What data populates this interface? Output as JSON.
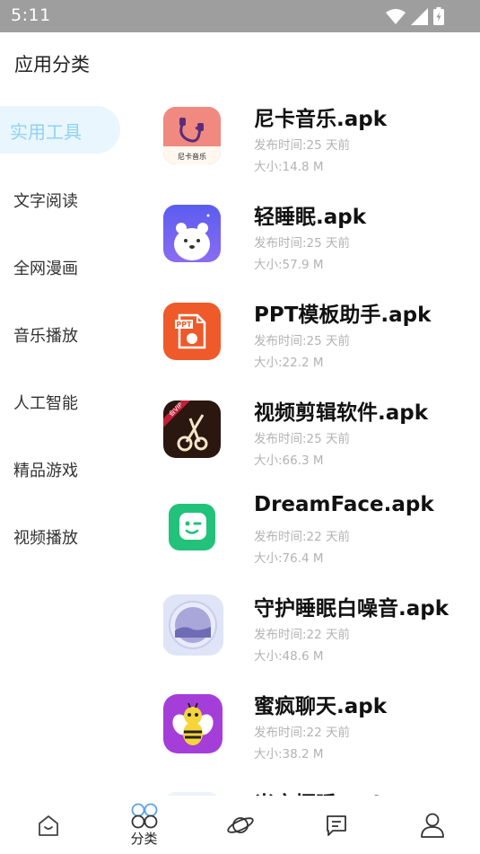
{
  "status_bar": {
    "time": "5:11"
  },
  "header": {
    "title": "应用分类"
  },
  "sidebar": {
    "items": [
      {
        "label": "实用工具",
        "active": true
      },
      {
        "label": "文字阅读"
      },
      {
        "label": "全网漫画"
      },
      {
        "label": "音乐播放"
      },
      {
        "label": "人工智能"
      },
      {
        "label": "精品游戏"
      },
      {
        "label": "视频播放"
      }
    ]
  },
  "apps": [
    {
      "name": "尼卡音乐.apk",
      "date": "发布时间:25 天前",
      "size": "大小:14.8 M",
      "icon": "nika-music-icon",
      "icon_text": "尼卡音乐"
    },
    {
      "name": "轻睡眠.apk",
      "date": "发布时间:25 天前",
      "size": "大小:57.9 M",
      "icon": "polar-bear-icon"
    },
    {
      "name": "PPT模板助手.apk",
      "date": "发布时间:25 天前",
      "size": "大小:22.2 M",
      "icon": "ppt-file-icon",
      "icon_text": "PPT"
    },
    {
      "name": "视频剪辑软件.apk",
      "date": "发布时间:25 天前",
      "size": "大小:66.3 M",
      "icon": "film-scissors-icon",
      "icon_text": "会VIP"
    },
    {
      "name": "DreamFace.apk",
      "date": "发布时间:22 天前",
      "size": "大小:76.4 M",
      "icon": "dreamface-icon"
    },
    {
      "name": "守护睡眠白噪音.apk",
      "date": "发布时间:22 天前",
      "size": "大小:48.6 M",
      "icon": "moon-lake-icon"
    },
    {
      "name": "蜜疯聊天.apk",
      "date": "发布时间:22 天前",
      "size": "大小:38.2 M",
      "icon": "bee-icon"
    },
    {
      "name": "光文摆睡.apk",
      "date": "",
      "size": "",
      "icon": "partial-app-icon"
    }
  ],
  "bottom_nav": {
    "items": [
      {
        "icon": "home-icon",
        "label": ""
      },
      {
        "icon": "category-icon",
        "label": "分类"
      },
      {
        "icon": "planet-icon",
        "label": ""
      },
      {
        "icon": "message-icon",
        "label": ""
      },
      {
        "icon": "profile-icon",
        "label": ""
      }
    ]
  },
  "colors": {
    "status_bar": "#9e9e9e",
    "sidebar_active_bg": "#e9f6fd",
    "sidebar_active_text": "#8fd3f3",
    "muted_text": "#b3b3b3"
  }
}
